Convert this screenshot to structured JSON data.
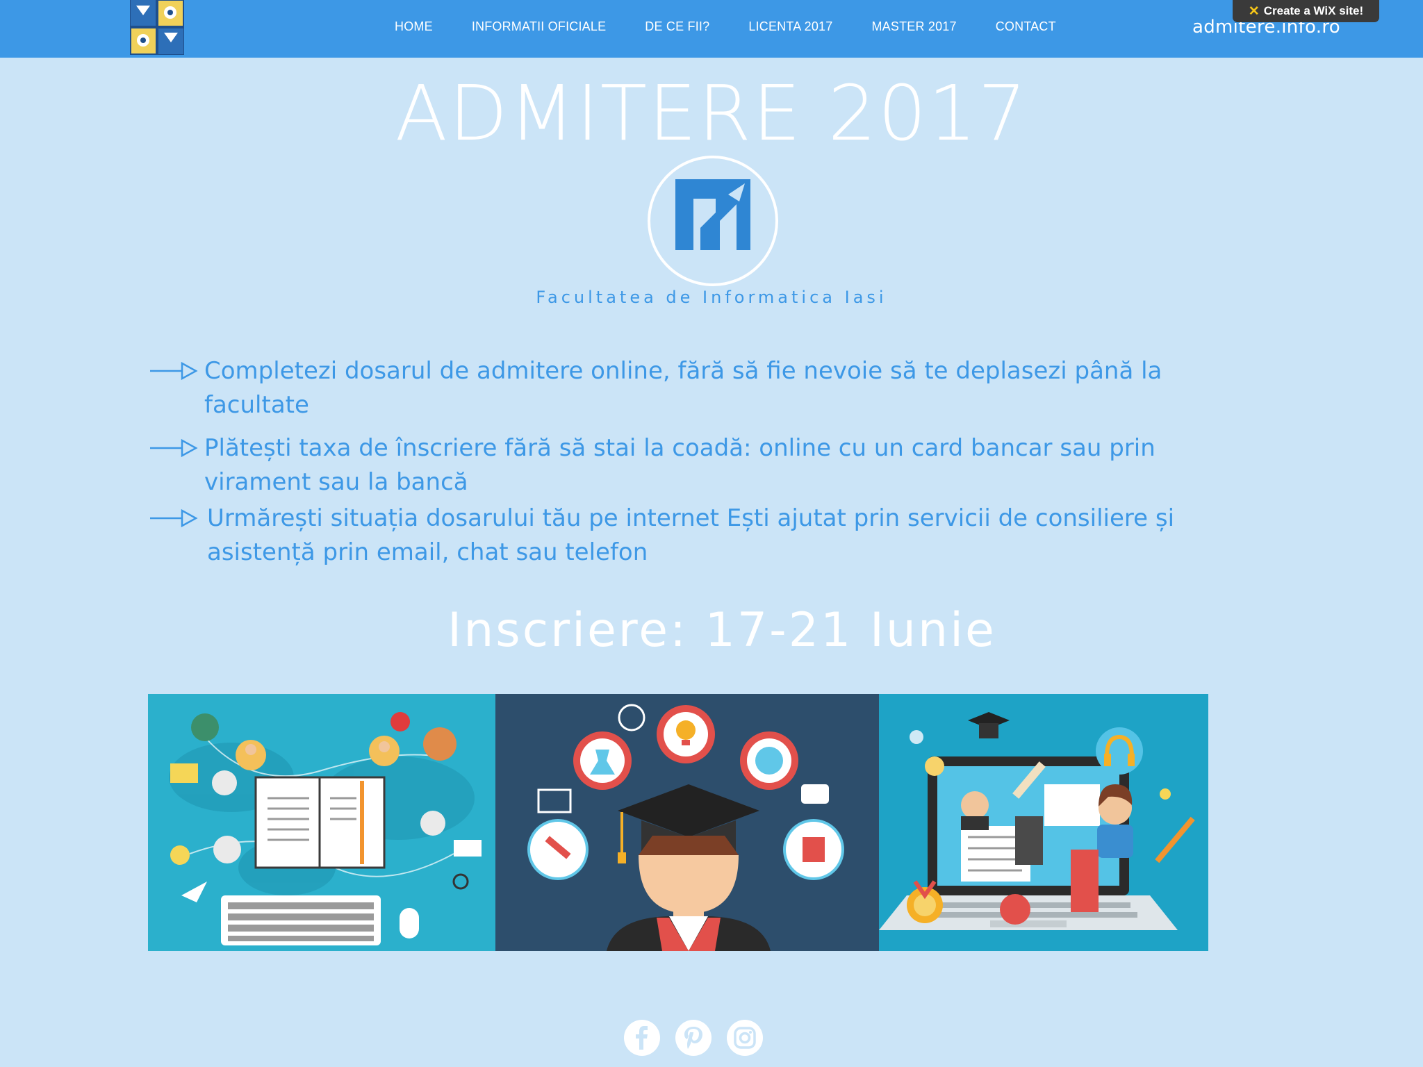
{
  "nav": {
    "items": [
      {
        "label": "HOME"
      },
      {
        "label": "INFORMATII OFICIALE"
      },
      {
        "label": "DE CE FII?"
      },
      {
        "label": "LICENTA 2017"
      },
      {
        "label": "MASTER 2017"
      },
      {
        "label": "CONTACT"
      }
    ],
    "domain": "admitere.info.ro",
    "wix_banner": "Create a WiX site!"
  },
  "hero": {
    "title": "ADMITERE 2017",
    "logo_caption": "Facultatea de Informatica Iasi"
  },
  "features": [
    {
      "text": "Completezi dosarul de admitere online, fără să fie nevoie să te deplasezi până la facultate"
    },
    {
      "text": "Plătești taxa de înscriere fără să stai la coadă: online cu un card bancar sau prin virament sau la bancă"
    },
    {
      "text": "Urmărești situația dosarului tău pe internet Ești ajutat prin servicii de consiliere și asistență prin email, chat sau telefon"
    }
  ],
  "registration": {
    "text": "Inscriere:  17-21 Iunie"
  },
  "colors": {
    "background": "#cbe4f7",
    "topbar": "#3d98e6",
    "accent": "#3d98e6",
    "logo_blue": "#2f86d3"
  },
  "social": [
    {
      "icon": "facebook-icon"
    },
    {
      "icon": "pinterest-icon"
    },
    {
      "icon": "instagram-icon"
    }
  ]
}
